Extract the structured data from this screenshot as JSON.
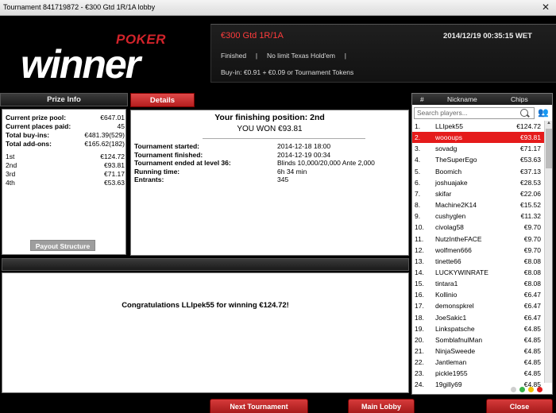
{
  "window": {
    "title": "Tournament 841719872 - €300 Gtd 1R/1A lobby",
    "close_glyph": "✕"
  },
  "logo": {
    "poker_text": "POKER",
    "winner_text": "winner"
  },
  "tournament": {
    "name": "€300 Gtd 1R/1A",
    "datetime": "2014/12/19 00:35:15 WET",
    "status_line": "Finished     |     No limit Texas Hold'em     |",
    "buyin_line": "Buy-in: €0.91 + €0.09 or Tournament Tokens"
  },
  "prize_info": {
    "header": "Prize Info",
    "stats": [
      {
        "label": "Current prize pool:",
        "value": "€647.01"
      },
      {
        "label": "Current places paid:",
        "value": "45"
      },
      {
        "label": "Total buy-ins:",
        "value": "€481.39(529)"
      },
      {
        "label": "Total add-ons:",
        "value": "€165.62(182)"
      }
    ],
    "places": [
      {
        "label": "1st",
        "value": "€124.72"
      },
      {
        "label": "2nd",
        "value": "€93.81"
      },
      {
        "label": "3rd",
        "value": "€71.17"
      },
      {
        "label": "4th",
        "value": "€53.63"
      }
    ],
    "payout_button": "Payout Structure"
  },
  "details": {
    "tab_label": "Details",
    "finishing_position": "Your finishing position: 2nd",
    "you_won": "YOU WON €93.81",
    "rows": [
      {
        "label": "Tournament started:",
        "value": "2014-12-18 18:00"
      },
      {
        "label": "Tournament finished:",
        "value": "2014-12-19 00:34"
      },
      {
        "label": "Tournament ended at level 36:",
        "value": "Blinds 10,000/20,000 Ante 2,000"
      },
      {
        "label": "Running time:",
        "value": "6h 34 min"
      },
      {
        "label": "Entrants:",
        "value": "345"
      }
    ]
  },
  "chat": {
    "message": "Congratulations LLIpek55 for winning €124.72!"
  },
  "players": {
    "headers": {
      "rank": "#",
      "nickname": "Nickname",
      "chips": "Chips"
    },
    "search_placeholder": "Search players...",
    "rows": [
      {
        "rank": "1.",
        "name": "LLIpek55",
        "chips": "€124.72"
      },
      {
        "rank": "2.",
        "name": "woooups",
        "chips": "€93.81",
        "selected": true
      },
      {
        "rank": "3.",
        "name": "sovadg",
        "chips": "€71.17"
      },
      {
        "rank": "4.",
        "name": "TheSuperEgo",
        "chips": "€53.63"
      },
      {
        "rank": "5.",
        "name": "Boomich",
        "chips": "€37.13"
      },
      {
        "rank": "6.",
        "name": "joshuajake",
        "chips": "€28.53"
      },
      {
        "rank": "7.",
        "name": "skifar",
        "chips": "€22.06"
      },
      {
        "rank": "8.",
        "name": "Machine2K14",
        "chips": "€15.52"
      },
      {
        "rank": "9.",
        "name": "cushyglen",
        "chips": "€11.32"
      },
      {
        "rank": "10.",
        "name": "civolag58",
        "chips": "€9.70"
      },
      {
        "rank": "11.",
        "name": "NutzIntheFACE",
        "chips": "€9.70"
      },
      {
        "rank": "12.",
        "name": "wolfmen666",
        "chips": "€9.70"
      },
      {
        "rank": "13.",
        "name": "tinette66",
        "chips": "€8.08"
      },
      {
        "rank": "14.",
        "name": "LUCKYWINRATE",
        "chips": "€8.08"
      },
      {
        "rank": "15.",
        "name": "tintara1",
        "chips": "€8.08"
      },
      {
        "rank": "16.",
        "name": "Kollinio",
        "chips": "€6.47"
      },
      {
        "rank": "17.",
        "name": "demonspkrel",
        "chips": "€6.47"
      },
      {
        "rank": "18.",
        "name": "JoeSakic1",
        "chips": "€6.47"
      },
      {
        "rank": "19.",
        "name": "Linkspatsche",
        "chips": "€4.85"
      },
      {
        "rank": "20.",
        "name": "SomblafnulMan",
        "chips": "€4.85"
      },
      {
        "rank": "21.",
        "name": "NinjaSweede",
        "chips": "€4.85"
      },
      {
        "rank": "22.",
        "name": "Jantleman",
        "chips": "€4.85"
      },
      {
        "rank": "23.",
        "name": "pickle1955",
        "chips": "€4.85"
      },
      {
        "rank": "24.",
        "name": "19gilly69",
        "chips": "€4.85"
      }
    ],
    "status_dots": [
      "#cfcfcf",
      "#39b54a",
      "#f2c200",
      "#e51b1b"
    ]
  },
  "bottom_buttons": {
    "next_tournament": "Next Tournament",
    "main_lobby": "Main Lobby",
    "close": "Close"
  }
}
